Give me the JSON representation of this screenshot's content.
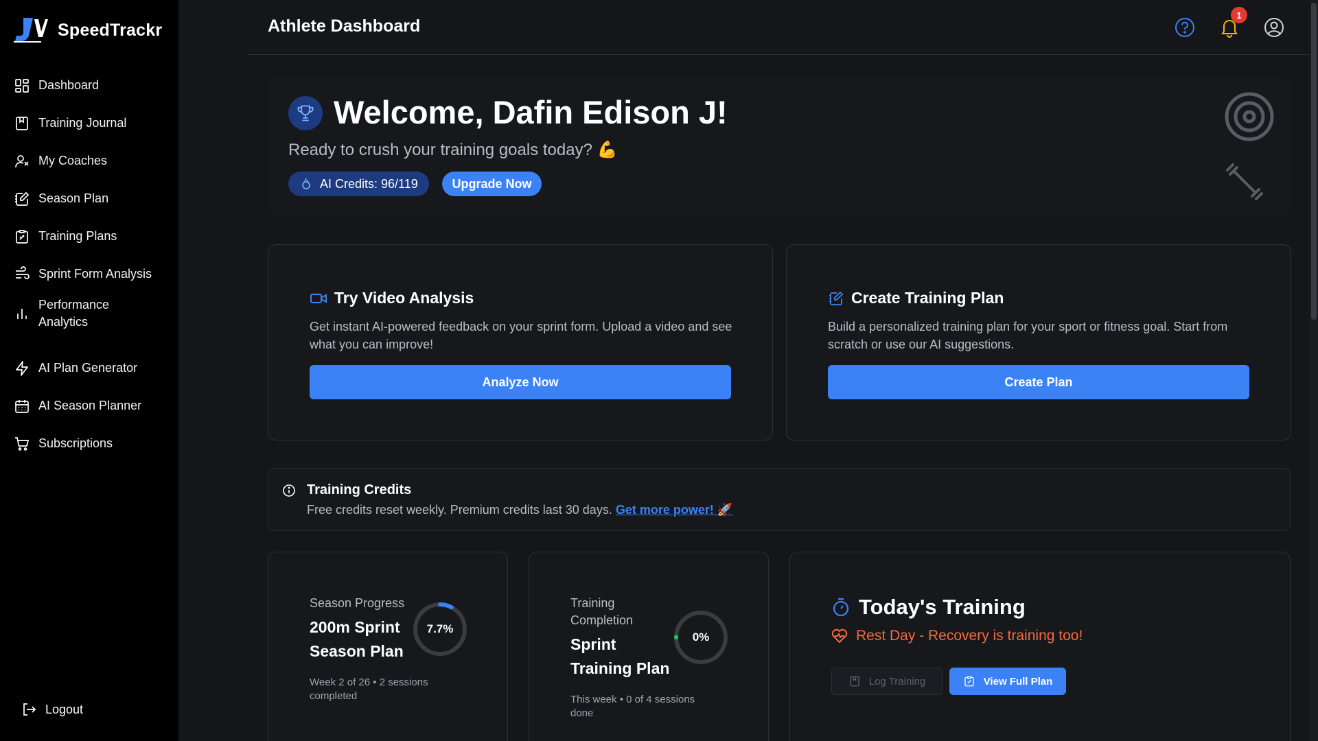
{
  "brand": {
    "name": "SpeedTrackr"
  },
  "sidebar": {
    "items": [
      {
        "label": "Dashboard",
        "icon": "dashboard-icon"
      },
      {
        "label": "Training Journal",
        "icon": "journal-icon"
      },
      {
        "label": "My Coaches",
        "icon": "coaches-icon"
      },
      {
        "label": "Season Plan",
        "icon": "season-plan-icon"
      },
      {
        "label": "Training Plans",
        "icon": "training-plans-icon"
      },
      {
        "label": "Sprint Form Analysis",
        "icon": "sprint-analysis-icon"
      },
      {
        "label": "Performance Analytics",
        "icon": "analytics-icon"
      },
      {
        "label": "AI Plan Generator",
        "icon": "lightning-icon"
      },
      {
        "label": "AI Season Planner",
        "icon": "calendar-icon"
      },
      {
        "label": "Subscriptions",
        "icon": "cart-icon"
      }
    ],
    "logout": "Logout"
  },
  "header": {
    "title": "Athlete Dashboard",
    "notification_count": "1"
  },
  "welcome": {
    "title": "Welcome, Dafin Edison J!",
    "subtitle": "Ready to crush your training goals today? 💪",
    "credits": "AI Credits: 96/119",
    "upgrade": "Upgrade Now"
  },
  "actions": [
    {
      "title": "Try Video Analysis",
      "desc": "Get instant AI-powered feedback on your sprint form. Upload a video and see what you can improve!",
      "button": "Analyze Now"
    },
    {
      "title": "Create Training Plan",
      "desc": "Build a personalized training plan for your sport or fitness goal. Start from scratch or use our AI suggestions.",
      "button": "Create Plan"
    }
  ],
  "credits_info": {
    "title": "Training Credits",
    "text": "Free credits reset weekly. Premium credits last 30 days.",
    "link": "Get more power! 🚀"
  },
  "stats": [
    {
      "label": "Season Progress",
      "name_line1": "200m Sprint",
      "name_line2": "Season Plan",
      "percent": 7.7,
      "percent_label": "7.7%",
      "foot_line1": "Week 2 of 26 • 2 sessions",
      "foot_line2": "completed"
    },
    {
      "label_line1": "Training",
      "label_line2": "Completion",
      "name_line1": "Sprint",
      "name_line2": "Training Plan",
      "percent": 0,
      "percent_label": "0%",
      "foot_line1": "This week • 0 of 4 sessions",
      "foot_line2": "done"
    }
  ],
  "today": {
    "title": "Today's Training",
    "rest": "Rest Day - Recovery is training too!",
    "log": "Log Training",
    "view": "View Full Plan"
  },
  "colors": {
    "accent": "#3b82f6",
    "sidebar_bg": "#000000",
    "page_bg": "#15161a",
    "rest_text": "#f56a3d",
    "badge": "#e53935",
    "progress_alt": "#22c55e"
  }
}
